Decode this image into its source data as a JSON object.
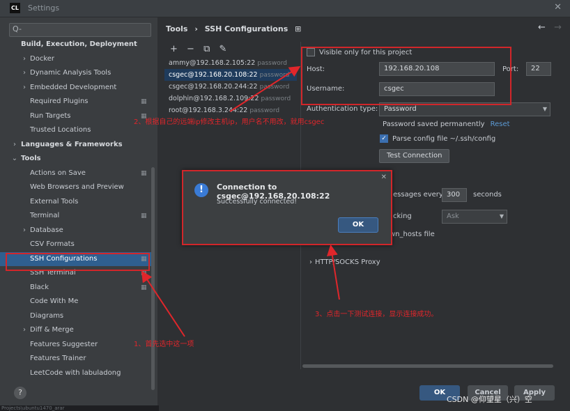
{
  "window": {
    "title": "Settings",
    "app_icon": "CL"
  },
  "sidebar": {
    "search_placeholder": "Q-",
    "items": [
      {
        "label": "Build, Execution, Deployment",
        "level": 0,
        "bold": true,
        "arrow": "",
        "pin": false
      },
      {
        "label": "Docker",
        "level": 1,
        "arrow": ">",
        "pin": false
      },
      {
        "label": "Dynamic Analysis Tools",
        "level": 1,
        "arrow": ">",
        "pin": false
      },
      {
        "label": "Embedded Development",
        "level": 1,
        "arrow": ">",
        "pin": false
      },
      {
        "label": "Required Plugins",
        "level": 1,
        "arrow": "",
        "pin": true
      },
      {
        "label": "Run Targets",
        "level": 1,
        "arrow": "",
        "pin": true
      },
      {
        "label": "Trusted Locations",
        "level": 1,
        "arrow": "",
        "pin": false
      },
      {
        "label": "Languages & Frameworks",
        "level": 0,
        "bold": true,
        "arrow": ">",
        "pin": false
      },
      {
        "label": "Tools",
        "level": 0,
        "bold": true,
        "arrow": "v",
        "pin": false
      },
      {
        "label": "Actions on Save",
        "level": 1,
        "arrow": "",
        "pin": true
      },
      {
        "label": "Web Browsers and Preview",
        "level": 1,
        "arrow": "",
        "pin": false
      },
      {
        "label": "External Tools",
        "level": 1,
        "arrow": "",
        "pin": false
      },
      {
        "label": "Terminal",
        "level": 1,
        "arrow": "",
        "pin": true
      },
      {
        "label": "Database",
        "level": 1,
        "arrow": ">",
        "pin": false
      },
      {
        "label": "CSV Formats",
        "level": 1,
        "arrow": "",
        "pin": false
      },
      {
        "label": "SSH Configurations",
        "level": 1,
        "arrow": "",
        "pin": true,
        "selected": true
      },
      {
        "label": "SSH Terminal",
        "level": 1,
        "arrow": "",
        "pin": true
      },
      {
        "label": "Black",
        "level": 1,
        "arrow": "",
        "pin": true
      },
      {
        "label": "Code With Me",
        "level": 1,
        "arrow": "",
        "pin": false
      },
      {
        "label": "Diagrams",
        "level": 1,
        "arrow": "",
        "pin": false
      },
      {
        "label": "Diff & Merge",
        "level": 1,
        "arrow": ">",
        "pin": false
      },
      {
        "label": "Features Suggester",
        "level": 1,
        "arrow": "",
        "pin": false
      },
      {
        "label": "Features Trainer",
        "level": 1,
        "arrow": "",
        "pin": false
      },
      {
        "label": "LeetCode with labuladong",
        "level": 1,
        "arrow": "",
        "pin": false
      }
    ],
    "help": "?"
  },
  "breadcrumb": [
    "Tools",
    "›",
    "SSH Configurations",
    "⊞"
  ],
  "nav": {
    "back": "←",
    "forward": "→"
  },
  "toolbar": {
    "add": "+",
    "remove": "−",
    "copy": "⧉",
    "edit": "✎"
  },
  "hosts": [
    {
      "name": "ammy@192.168.2.105:22",
      "type": "password"
    },
    {
      "name": "csgec@192.168.20.108:22",
      "type": "password",
      "selected": true
    },
    {
      "name": "csgec@192.168.20.244:22",
      "type": "password"
    },
    {
      "name": "dolphin@192.168.2.109:22",
      "type": "password"
    },
    {
      "name": "root@192.168.3.244:22",
      "type": "password"
    }
  ],
  "form": {
    "visible_only": "Visible only for this project",
    "host_label": "Host:",
    "host_value": "192.168.20.108",
    "port_label": "Port:",
    "port_value": "22",
    "username_label": "Username:",
    "username_value": "csgec",
    "auth_label": "Authentication type:",
    "auth_value": "Password",
    "password_saved": "Password saved permanently",
    "reset": "Reset",
    "parse_config": "Parse config file ~/.ssh/config",
    "test_connection": "Test Connection",
    "keepalive_prefix": "essages every",
    "keepalive_value": "300",
    "keepalive_suffix": "seconds",
    "checking_label": "cking",
    "checking_value": "Ask",
    "known_hosts": "wn_hosts file",
    "proxy": "HTTP/SOCKS Proxy"
  },
  "dialog": {
    "title": "Connection to csgec@192.168.20.108:22",
    "message": "Successfully connected!",
    "ok": "OK",
    "icon": "!"
  },
  "buttons": {
    "ok": "OK",
    "cancel": "Cancel",
    "apply": "Apply"
  },
  "annotations": {
    "a1": "1、首先选中这一项",
    "a2": "2、根据自己的远端ip修改主机ip，用户名不用改，就用csgec",
    "a3": "3、点击一下测试连接，显示连接成功。"
  },
  "watermark": "CSDN @仰望星（兴）空",
  "console": "Projects\\ubuntu1470_arar"
}
